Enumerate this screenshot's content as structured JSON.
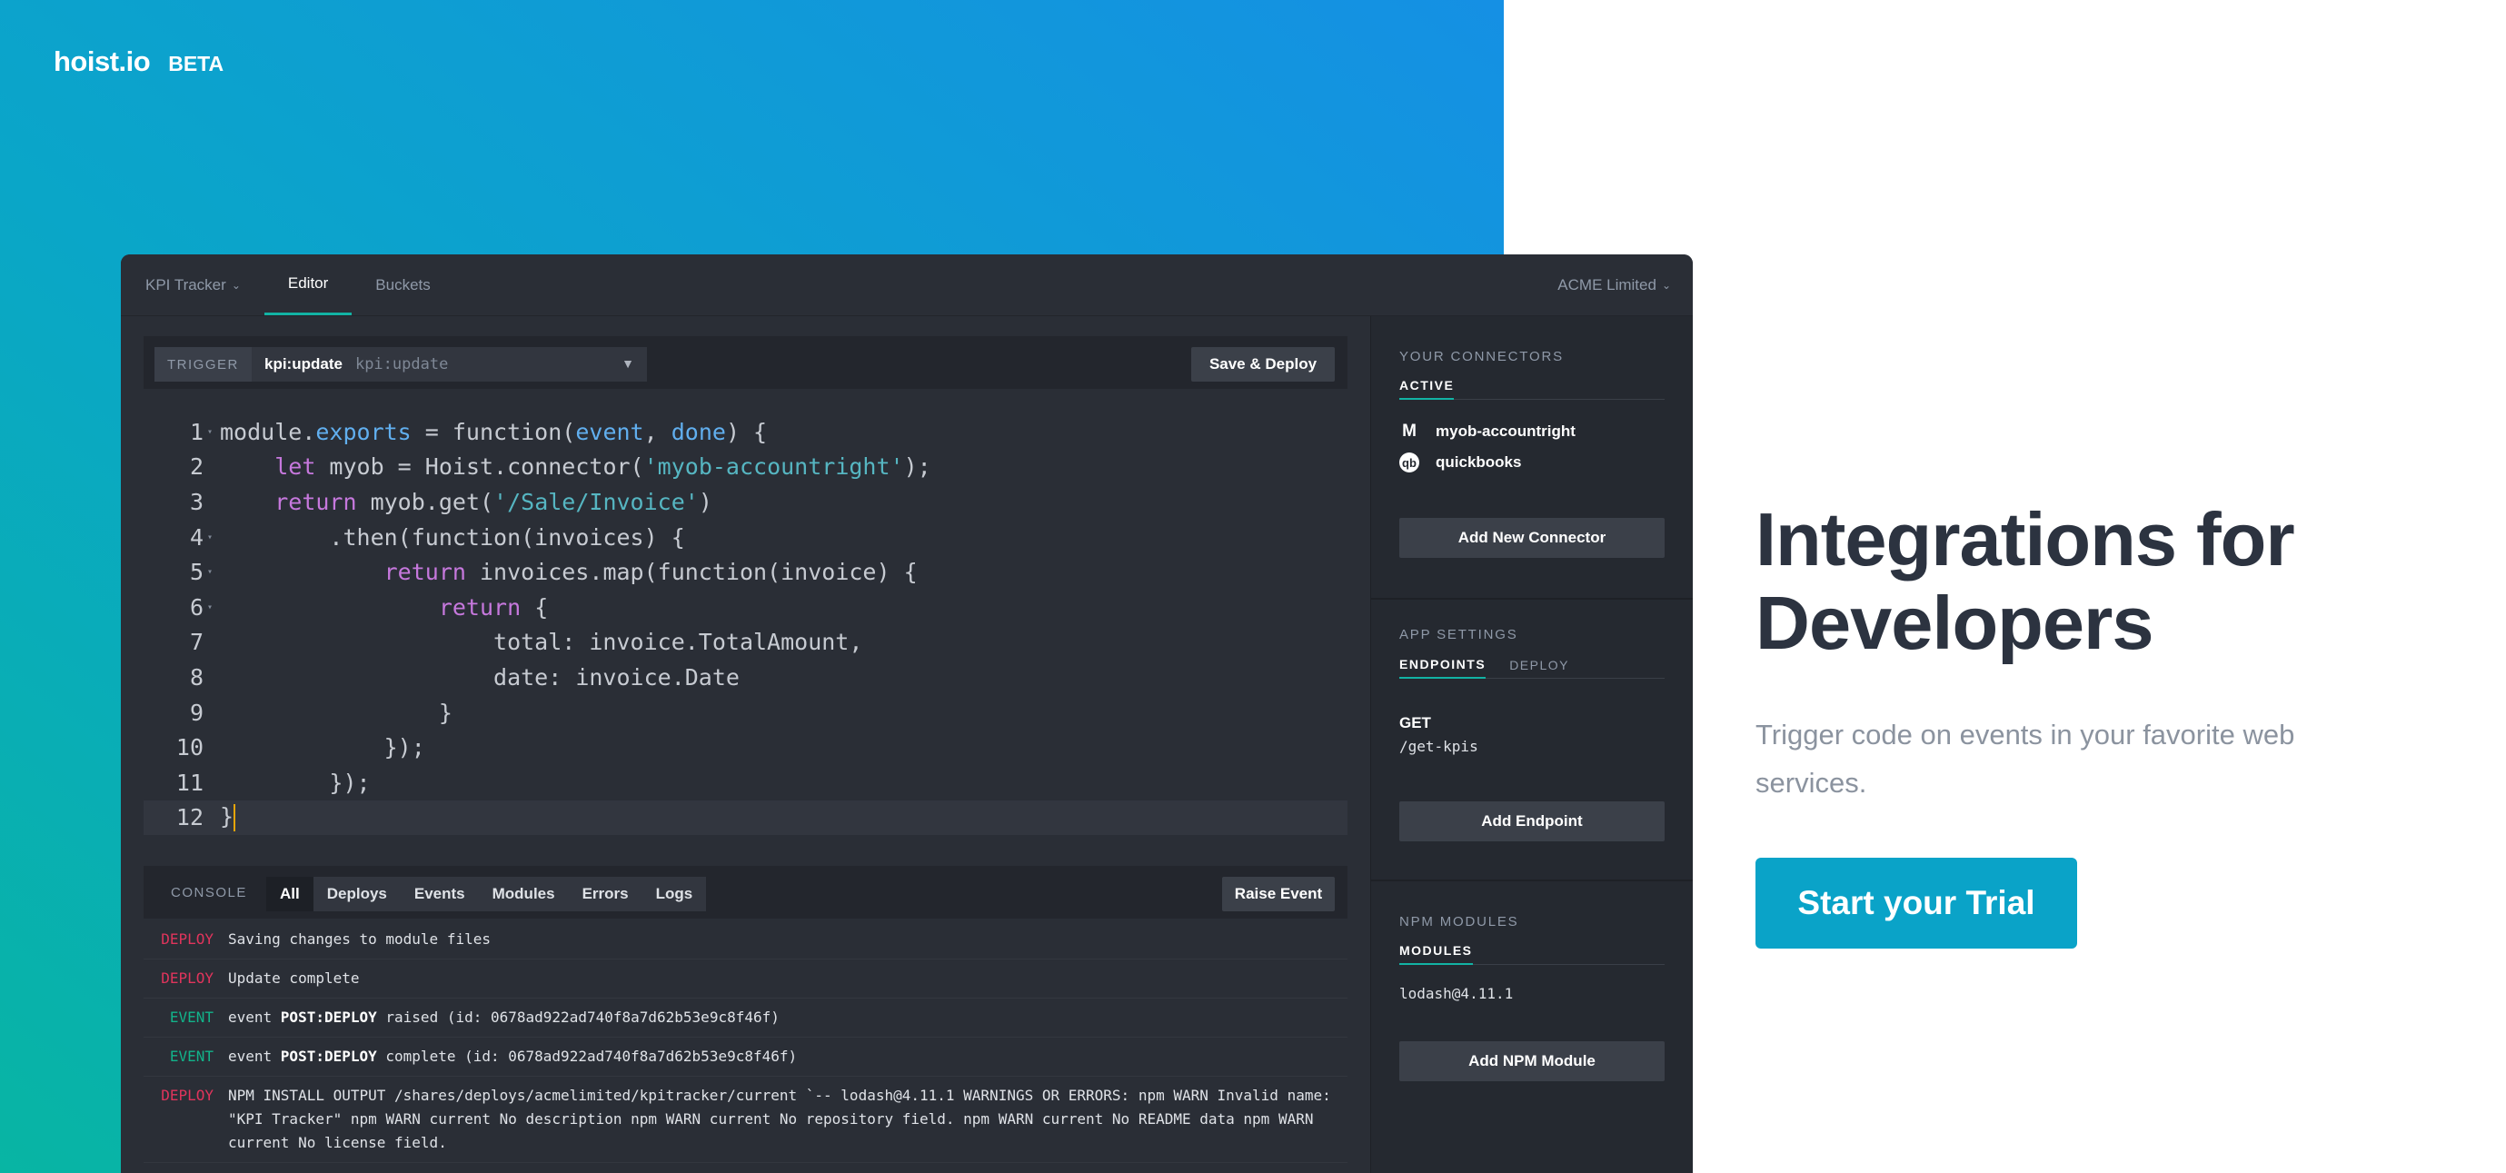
{
  "brand": {
    "logo": "hoist.io",
    "badge": "BETA"
  },
  "app": {
    "topbar": {
      "project": "KPI Tracker",
      "tabs": [
        "Editor",
        "Buckets"
      ],
      "active_tab": "Editor",
      "org": "ACME Limited"
    },
    "trigger": {
      "label": "TRIGGER",
      "name": "kpi:update",
      "value": "kpi:update",
      "save_label": "Save & Deploy"
    },
    "code": {
      "lines": [
        {
          "n": "1",
          "text": "module.exports = function(event, done) {",
          "fold": true
        },
        {
          "n": "2",
          "text": "    let myob = Hoist.connector('myob-accountright');",
          "fold": false
        },
        {
          "n": "3",
          "text": "    return myob.get('/Sale/Invoice')",
          "fold": false
        },
        {
          "n": "4",
          "text": "        .then(function(invoices) {",
          "fold": true
        },
        {
          "n": "5",
          "text": "            return invoices.map(function(invoice) {",
          "fold": true
        },
        {
          "n": "6",
          "text": "                return {",
          "fold": true
        },
        {
          "n": "7",
          "text": "                    total: invoice.TotalAmount,",
          "fold": false
        },
        {
          "n": "8",
          "text": "                    date: invoice.Date",
          "fold": false
        },
        {
          "n": "9",
          "text": "                }",
          "fold": false
        },
        {
          "n": "10",
          "text": "            });",
          "fold": false
        },
        {
          "n": "11",
          "text": "        });",
          "fold": false
        },
        {
          "n": "12",
          "text": "}",
          "fold": false
        }
      ]
    },
    "console": {
      "label": "CONSOLE",
      "filters": [
        "All",
        "Deploys",
        "Events",
        "Modules",
        "Errors",
        "Logs"
      ],
      "active_filter": "All",
      "raise_label": "Raise Event",
      "entries": [
        {
          "tag": "DEPLOY",
          "kind": "deploy",
          "pre": "Saving changes to module files",
          "bold": "",
          "post": ""
        },
        {
          "tag": "DEPLOY",
          "kind": "deploy",
          "pre": "Update complete",
          "bold": "",
          "post": ""
        },
        {
          "tag": "EVENT",
          "kind": "event",
          "pre": "event ",
          "bold": "POST:DEPLOY",
          "post": " raised (id: 0678ad922ad740f8a7d62b53e9c8f46f)"
        },
        {
          "tag": "EVENT",
          "kind": "event",
          "pre": "event ",
          "bold": "POST:DEPLOY",
          "post": " complete (id: 0678ad922ad740f8a7d62b53e9c8f46f)"
        },
        {
          "tag": "DEPLOY",
          "kind": "deploy",
          "pre": "NPM INSTALL OUTPUT /shares/deploys/acmelimited/kpitracker/current `-- lodash@4.11.1 WARNINGS OR ERRORS: npm WARN Invalid name: \"KPI Tracker\" npm WARN current No description npm WARN current No repository field. npm WARN current No README data npm WARN current No license field.",
          "bold": "",
          "post": ""
        }
      ]
    },
    "sidebar": {
      "connectors": {
        "title": "YOUR CONNECTORS",
        "tab": "ACTIVE",
        "items": [
          {
            "name": "myob-accountright",
            "icon": "myob-logo-icon",
            "glyph": "M"
          },
          {
            "name": "quickbooks",
            "icon": "quickbooks-logo-icon",
            "glyph": "qb"
          }
        ],
        "button": "Add New Connector"
      },
      "app_settings": {
        "title": "APP SETTINGS",
        "tabs": [
          "ENDPOINTS",
          "DEPLOY"
        ],
        "active_tab": "ENDPOINTS",
        "endpoint_method": "GET",
        "endpoint_path": "/get-kpis",
        "button": "Add Endpoint"
      },
      "npm": {
        "title": "NPM MODULES",
        "tab": "MODULES",
        "module": "lodash@4.11.1",
        "button": "Add NPM Module"
      }
    }
  },
  "marketing": {
    "headline": "Integrations for Developers",
    "subtext": "Trigger code on events in your favorite web services.",
    "cta": "Start your Trial"
  },
  "colors": {
    "accent": "#12b3a4",
    "cta": "#0aa3c8",
    "deploy_tag": "#e0345c",
    "event_tag": "#12b38a"
  }
}
